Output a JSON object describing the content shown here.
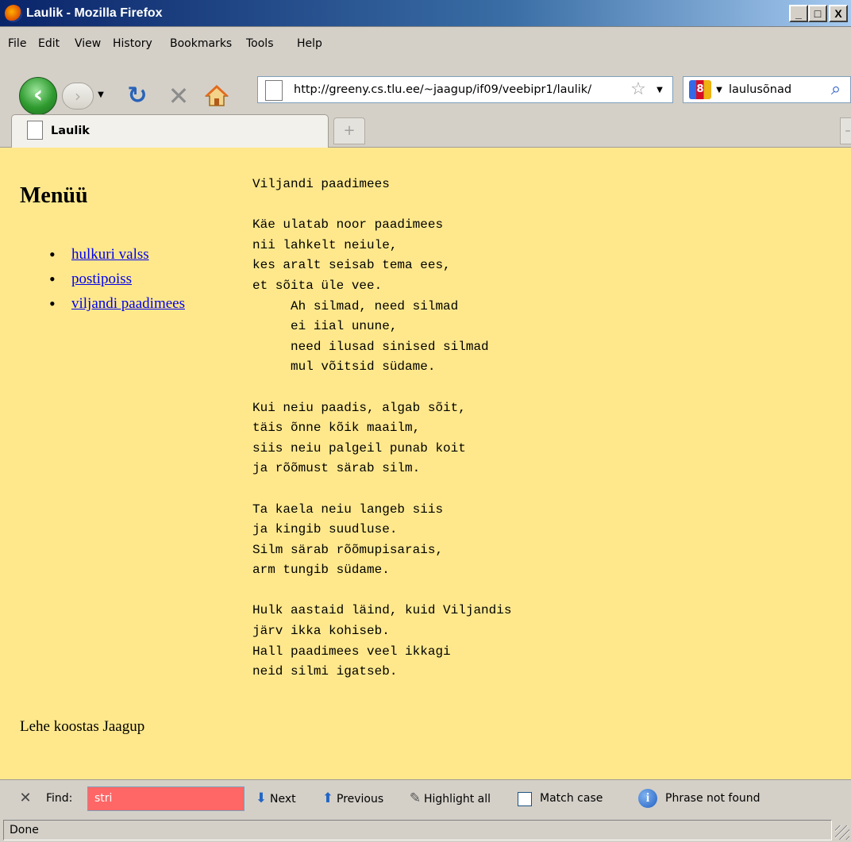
{
  "window": {
    "title": "Laulik - Mozilla Firefox",
    "minimize_glyph": "_",
    "maximize_glyph": "□",
    "close_glyph": "X"
  },
  "menubar": [
    "File",
    "Edit",
    "View",
    "History",
    "Bookmarks",
    "Tools",
    "Help"
  ],
  "navbar": {
    "url": "http://greeny.cs.tlu.ee/~jaagup/if09/veebipr1/laulik/",
    "search_text": "laulusõnad"
  },
  "tabs": {
    "active_label": "Laulik"
  },
  "page": {
    "menu_heading": "Menüü",
    "menu_links": [
      "hulkuri valss",
      "postipoiss",
      "viljandi paadimees"
    ],
    "lyrics": "Viljandi paadimees\n\nKäe ulatab noor paadimees\nnii lahkelt neiule,\nkes aralt seisab tema ees,\net sõita üle vee.\n     Ah silmad, need silmad\n     ei iial unune,\n     need ilusad sinised silmad\n     mul võitsid südame.\n\nKui neiu paadis, algab sõit,\ntäis õnne kõik maailm,\nsiis neiu palgeil punab koit\nja rõõmust särab silm.\n\nTa kaela neiu langeb siis\nja kingib suudluse.\nSilm särab rõõmupisarais,\narm tungib südame.\n\nHulk aastaid läind, kuid Viljandis\njärv ikka kohiseb.\nHall paadimees veel ikkagi\nneid silmi igatseb.",
    "footer": "Lehe koostas Jaagup"
  },
  "findbar": {
    "label": "Find:",
    "query": "stri",
    "next_label": "Next",
    "previous_label": "Previous",
    "highlight_label": "Highlight all",
    "match_case_label": "Match case",
    "match_case_checked": false,
    "status": "Phrase not found"
  },
  "statusbar": {
    "text": "Done"
  },
  "colors": {
    "page_background": "#ffe88c",
    "link": "#0000ee",
    "find_not_found": "#ff6666"
  },
  "icons": [
    "firefox-icon",
    "back-arrow-icon",
    "forward-arrow-icon",
    "reload-icon",
    "stop-icon",
    "home-icon",
    "page-icon",
    "bookmark-star-icon",
    "search-engine-icon",
    "magnifier-icon",
    "new-tab-icon",
    "close-icon",
    "down-arrow-icon",
    "up-arrow-icon",
    "highlighter-icon",
    "info-icon"
  ]
}
